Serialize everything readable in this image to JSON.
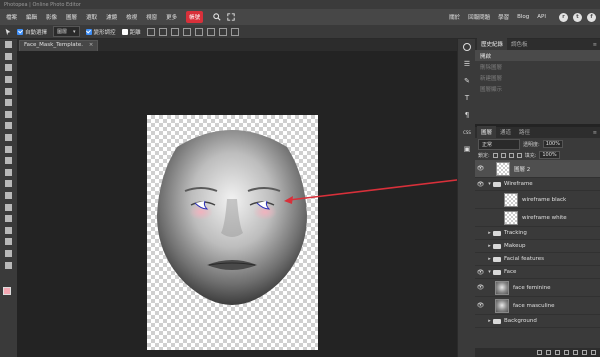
{
  "app": {
    "title": "Photopea | Online Photo Editor"
  },
  "menu": {
    "items": [
      "檔案",
      "編輯",
      "影像",
      "圖層",
      "選取",
      "濾鏡",
      "檢視",
      "視窗",
      "更多"
    ],
    "accent_item": "帳號",
    "right_items": [
      "關於",
      "回報問題",
      "學習",
      "Blog",
      "API"
    ],
    "social_icons": [
      "reddit-icon",
      "twitter-icon",
      "facebook-icon"
    ],
    "accent_color": "#d8303a"
  },
  "options": {
    "auto_select_label": "自動選擇",
    "auto_select_checked": true,
    "target_value": "圖層",
    "transform_label": "變形調控",
    "transform_checked": true,
    "distance_label": "距離",
    "distance_checked": false
  },
  "document": {
    "tab_label": "Face_Mask_Template.",
    "close_glyph": "×"
  },
  "side_strip": {
    "buttons": [
      "info-icon",
      "properties-icon",
      "brush-icon",
      "character-icon",
      "paragraph-icon",
      "css-icon",
      "image-icon"
    ]
  },
  "history_panel": {
    "tabs": [
      "歷史紀錄",
      "調色板"
    ],
    "items": [
      "開啟",
      "刪除圖層",
      "新建圖層",
      "圖層顯示"
    ],
    "active_index": 0
  },
  "layers_panel": {
    "tabs": [
      "圖層",
      "通道",
      "路徑"
    ],
    "blend_mode": "正常",
    "opacity_label": "透明度:",
    "opacity_value": "100%",
    "lock_label": "鎖定:",
    "fill_label": "填充:",
    "fill_value": "100%",
    "layers": [
      {
        "name": "圖層 2",
        "kind": "layer",
        "visible": true,
        "level": 0,
        "selected": true
      },
      {
        "name": "Wireframe",
        "kind": "folder",
        "visible": true,
        "level": 0,
        "expanded": true
      },
      {
        "name": "wireframe black",
        "kind": "layer",
        "visible": false,
        "level": 1
      },
      {
        "name": "wireframe white",
        "kind": "layer",
        "visible": false,
        "level": 1
      },
      {
        "name": "Tracking",
        "kind": "folder",
        "visible": false,
        "level": 0,
        "expanded": false
      },
      {
        "name": "Makeup",
        "kind": "folder",
        "visible": false,
        "level": 0,
        "expanded": false
      },
      {
        "name": "Facial features",
        "kind": "folder",
        "visible": false,
        "level": 0,
        "expanded": false
      },
      {
        "name": "Face",
        "kind": "folder",
        "visible": true,
        "level": 0,
        "expanded": true
      },
      {
        "name": "face feminine",
        "kind": "face",
        "visible": true,
        "level": 1
      },
      {
        "name": "face masculine",
        "kind": "face",
        "visible": true,
        "level": 1
      },
      {
        "name": "Background",
        "kind": "folder",
        "visible": false,
        "level": 0,
        "expanded": false
      }
    ]
  },
  "tools": [
    "move-icon",
    "marquee-icon",
    "lasso-icon",
    "magic-wand-icon",
    "crop-icon",
    "eyedropper-icon",
    "healing-icon",
    "brush-icon",
    "clone-stamp-icon",
    "history-brush-icon",
    "eraser-icon",
    "gradient-icon",
    "blur-icon",
    "dodge-icon",
    "pen-icon",
    "type-icon",
    "path-select-icon",
    "shape-icon",
    "hand-icon",
    "zoom-icon"
  ],
  "colors": {
    "foreground": "#f4a8b3",
    "background": "#ffffff",
    "annotation_arrow": "#d8303a"
  }
}
